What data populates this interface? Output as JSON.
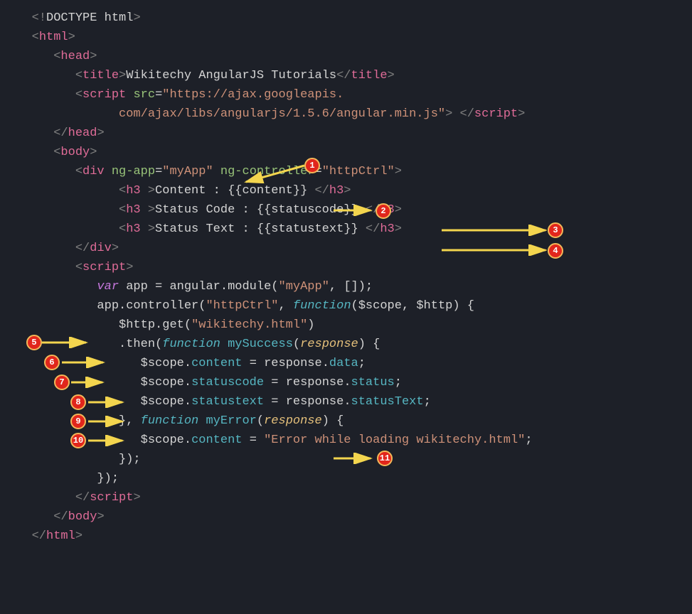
{
  "code": {
    "doctype": "<!DOCTYPE html>",
    "html_open": "html",
    "head_open": "head",
    "title_open": "title",
    "title_text": "Wikitechy AngularJS Tutorials",
    "title_close": "title",
    "script_open": "script",
    "src_attr": "src",
    "src_val": "\"https://ajax.googleapis.",
    "src_val2": "com/ajax/libs/angularjs/1.5.6/angular.min.js\"",
    "script_close": "script",
    "head_close": "head",
    "body_open": "body",
    "div_open": "div",
    "ngapp_attr": "ng-app",
    "ngapp_val": "\"myApp\"",
    "ngctrl_attr": "ng-controller",
    "ngctrl_val": "\"httpCtrl\"",
    "h3": "h3",
    "content_label": "Content : {{content}} ",
    "status_code_label": "Status Code : {{statuscode}} ",
    "status_text_label": "Status Text : {{statustext}} ",
    "div_close": "div",
    "var_kw": "var",
    "app_var": "app",
    "angular": "angular",
    "module": "module",
    "myapp_str": "\"myApp\"",
    "controller_fn": "controller",
    "httpctrl_str": "\"httpCtrl\"",
    "function_kw": "function",
    "scope_param": "$scope",
    "http_param": "$http",
    "get_fn": "get",
    "wikitechy_str": "\"wikitechy.html\"",
    "then_fn": "then",
    "mysuccess": "mySuccess",
    "response": "response",
    "content_mem": "content",
    "data_mem": "data",
    "statuscode_mem": "statuscode",
    "status_mem": "status",
    "statustext_mem": "statustext",
    "statusText_mem": "statusText",
    "myerror": "myError",
    "error_str": "\"Error while loading wikitechy.html\"",
    "body_close": "body",
    "html_close": "html"
  },
  "badges": {
    "b1": "1",
    "b2": "2",
    "b3": "3",
    "b4": "4",
    "b5": "5",
    "b6": "6",
    "b7": "7",
    "b8": "8",
    "b9": "9",
    "b10": "10",
    "b11": "11"
  }
}
